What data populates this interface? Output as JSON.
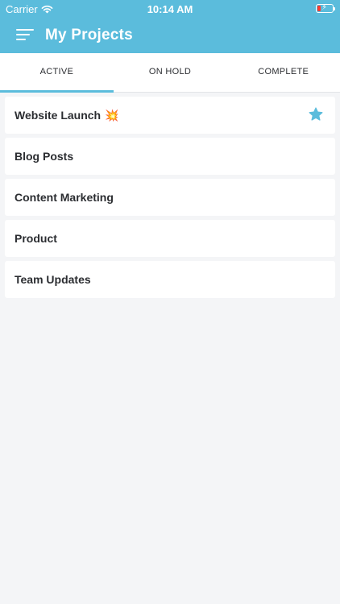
{
  "status_bar": {
    "carrier": "Carrier",
    "time": "10:14 AM"
  },
  "header": {
    "title": "My Projects"
  },
  "tabs": [
    {
      "label": "ACTIVE",
      "active": true
    },
    {
      "label": "ON HOLD",
      "active": false
    },
    {
      "label": "COMPLETE",
      "active": false
    }
  ],
  "projects": [
    {
      "name": "Website Launch",
      "emoji": "💥",
      "starred": true
    },
    {
      "name": "Blog Posts"
    },
    {
      "name": "Content Marketing"
    },
    {
      "name": "Product"
    },
    {
      "name": "Team Updates"
    }
  ],
  "colors": {
    "accent": "#5bbcdc",
    "background": "#f4f5f7",
    "battery_low": "#ff3b30"
  },
  "icons": {
    "menu": "hamburger-menu-icon",
    "wifi": "wifi-icon",
    "battery": "battery-icon",
    "star": "star-icon"
  }
}
